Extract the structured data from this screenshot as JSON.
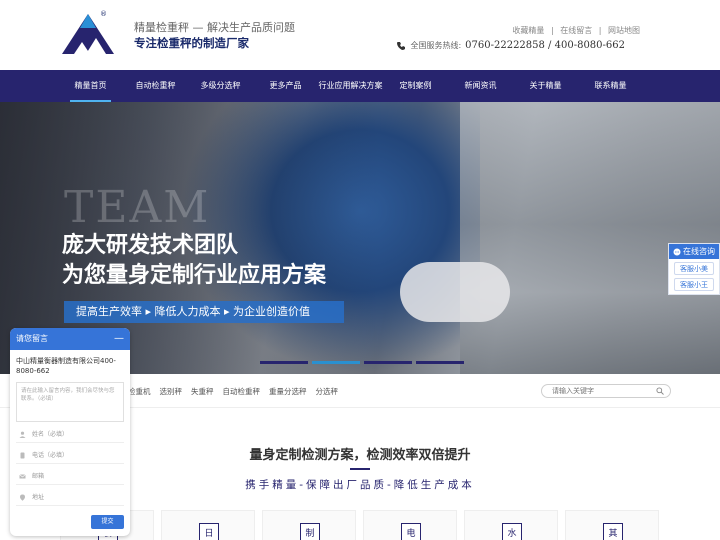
{
  "header": {
    "logo_mark": "®",
    "tagline1": "精量检重秤 — 解决生产品质问题",
    "tagline2": "专注检重秤的制造厂家",
    "toplinks": [
      "收藏精量",
      "|",
      "在线留言",
      "|",
      "网站地图"
    ],
    "hotline_label": "全国服务热线:",
    "hotline_numbers": "0760-22222858 / 400-8080-662"
  },
  "nav": {
    "items": [
      {
        "label": "精量首页",
        "active": true
      },
      {
        "label": "自动检重秤"
      },
      {
        "label": "多级分选秤"
      },
      {
        "label": "更多产品"
      },
      {
        "label": "行业应用解决方案"
      },
      {
        "label": "定制案例"
      },
      {
        "label": "新闻资讯"
      },
      {
        "label": "关于精量"
      },
      {
        "label": "联系精量"
      }
    ]
  },
  "banner": {
    "watermark": "TEAM",
    "headline1": "庞大研发技术团队",
    "headline2": "为您量身定制行业应用方案",
    "subline": "提高生产效率 ▸ 降低人力成本 ▸ 为企业创造价值",
    "slides": 4,
    "active_slide": 2
  },
  "searchbar": {
    "hotwords": [
      "检重机",
      "选别秤",
      "失重秤",
      "自动检重秤",
      "重量分选秤",
      "分选秤"
    ],
    "placeholder": "请输入关键字"
  },
  "section": {
    "title": "量身定制检测方案，检测效率双倍提升",
    "subtitle": "携手精量-保障出厂品质-降低生产成本",
    "cards": [
      "食",
      "日",
      "制",
      "电",
      "水",
      "其"
    ]
  },
  "consult": {
    "title": "在线咨询",
    "agents": [
      "客服小美",
      "客服小王"
    ]
  },
  "message": {
    "title": "请您留言",
    "minimize": "—",
    "company": "中山精量衡器制造有限公司400-8080-662",
    "textarea_placeholder": "请在此输入留言内容，我们会尽快与您联系。（必填）",
    "fields": [
      "姓名（必填）",
      "电话（必填）",
      "邮箱",
      "地址"
    ],
    "submit": "提交"
  },
  "colors": {
    "nav_bg": "#27246e",
    "accent": "#3674d8",
    "nav_underline": "#4fb3f0"
  }
}
